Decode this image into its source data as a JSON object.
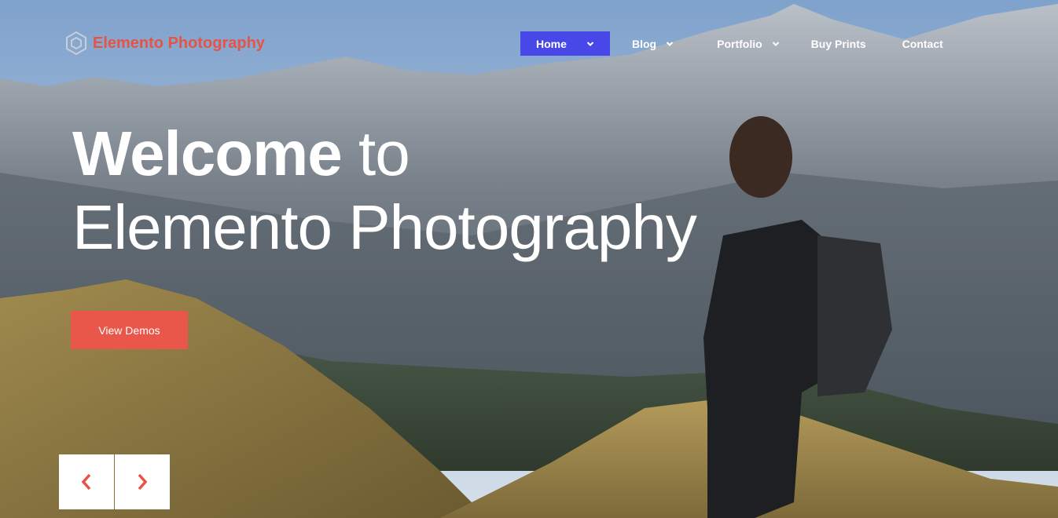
{
  "brand": {
    "name": "Elemento Photography",
    "color": "#e85347",
    "icon": "hexagon-logo-icon"
  },
  "nav": {
    "items": [
      {
        "label": "Home",
        "active": true,
        "has_dropdown": true
      },
      {
        "label": "Blog",
        "active": false,
        "has_dropdown": true
      },
      {
        "label": "Portfolio",
        "active": false,
        "has_dropdown": true
      },
      {
        "label": "Buy Prints",
        "active": false,
        "has_dropdown": false
      },
      {
        "label": "Contact",
        "active": false,
        "has_dropdown": false
      }
    ],
    "active_color": "#4848e8"
  },
  "hero": {
    "title_bold": "Welcome",
    "title_light": " to",
    "title_line2": "Elemento Photography",
    "cta_label": "View Demos",
    "cta_color": "#e8574a"
  },
  "slider": {
    "prev_icon": "chevron-left-icon",
    "next_icon": "chevron-right-icon",
    "arrow_color": "#e85347"
  }
}
